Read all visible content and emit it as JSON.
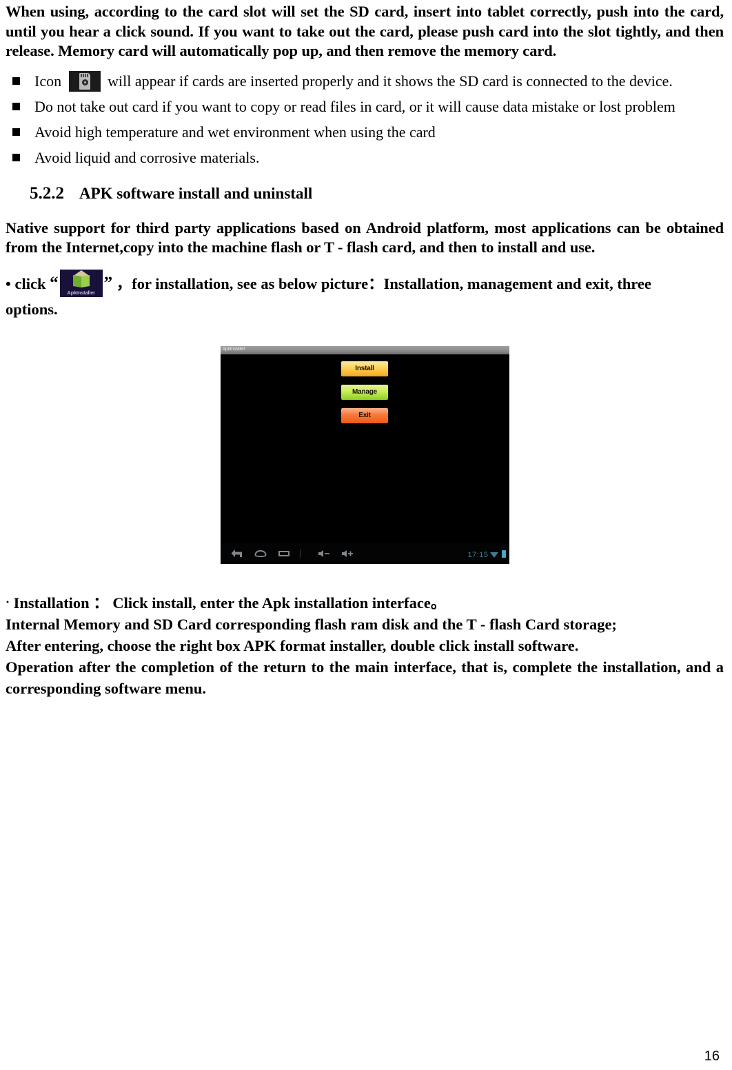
{
  "document": {
    "page_number": "16"
  },
  "intro_paragraph": "When using, according to the card slot will set the SD card, insert into tablet correctly, push into the card, until you hear a click sound. If you want to take out the card, please push card into the slot tightly, and then release. Memory card will automatically pop up, and then remove the memory card.",
  "bullets": [
    {
      "icon": "sd-card-icon",
      "text_before": "Icon",
      "text_after": "will appear if cards are inserted properly and it shows the SD card is connected to the device."
    },
    {
      "text": "Do not take out card if you want to copy or read files in card, or it will cause data mistake or lost problem"
    },
    {
      "text": "Avoid high temperature and wet environment when using the card"
    },
    {
      "text": "Avoid liquid and corrosive materials."
    }
  ],
  "section": {
    "number": "5.2.2",
    "title": "APK software install and uninstall"
  },
  "native_support_paragraph": "Native support for third party applications based on Android platform, most applications can be obtained from the Internet,copy into the machine flash or T - flash card, and then to install and use.",
  "click_line": {
    "lead": "• click",
    "open_quote": "“",
    "icon_label": "ApkInstaller",
    "close_quote": "”",
    "after": "，for installation, see as below picture：Installation, management and exit, three",
    "second_line": "options."
  },
  "screenshot": {
    "titlebar_text": "ApkInstaller",
    "buttons": [
      {
        "label": "Install",
        "color": "#f5a61c"
      },
      {
        "label": "Manage",
        "color": "#8ccf24"
      },
      {
        "label": "Exit",
        "color": "#ef5a17"
      }
    ],
    "navbar": {
      "back_icon": "back-icon",
      "home_icon": "home-icon",
      "recents_icon": "recents-icon",
      "volume_down_icon": "volume-down-icon",
      "volume_up_icon": "volume-up-icon",
      "clock": "17:15",
      "wifi_icon": "wifi-icon",
      "battery_icon": "battery-icon"
    }
  },
  "closing": {
    "line1_lead": "·",
    "line1": "Installation  ：  Click install, enter the Apk installation interface。",
    "line2": "Internal Memory and SD Card corresponding flash ram disk and the T - flash Card storage;",
    "line3": "After entering, choose the right box APK format installer, double click install software.",
    "line4": "Operation after the completion of the return to the main interface, that is, complete the installation, and a corresponding software menu."
  }
}
